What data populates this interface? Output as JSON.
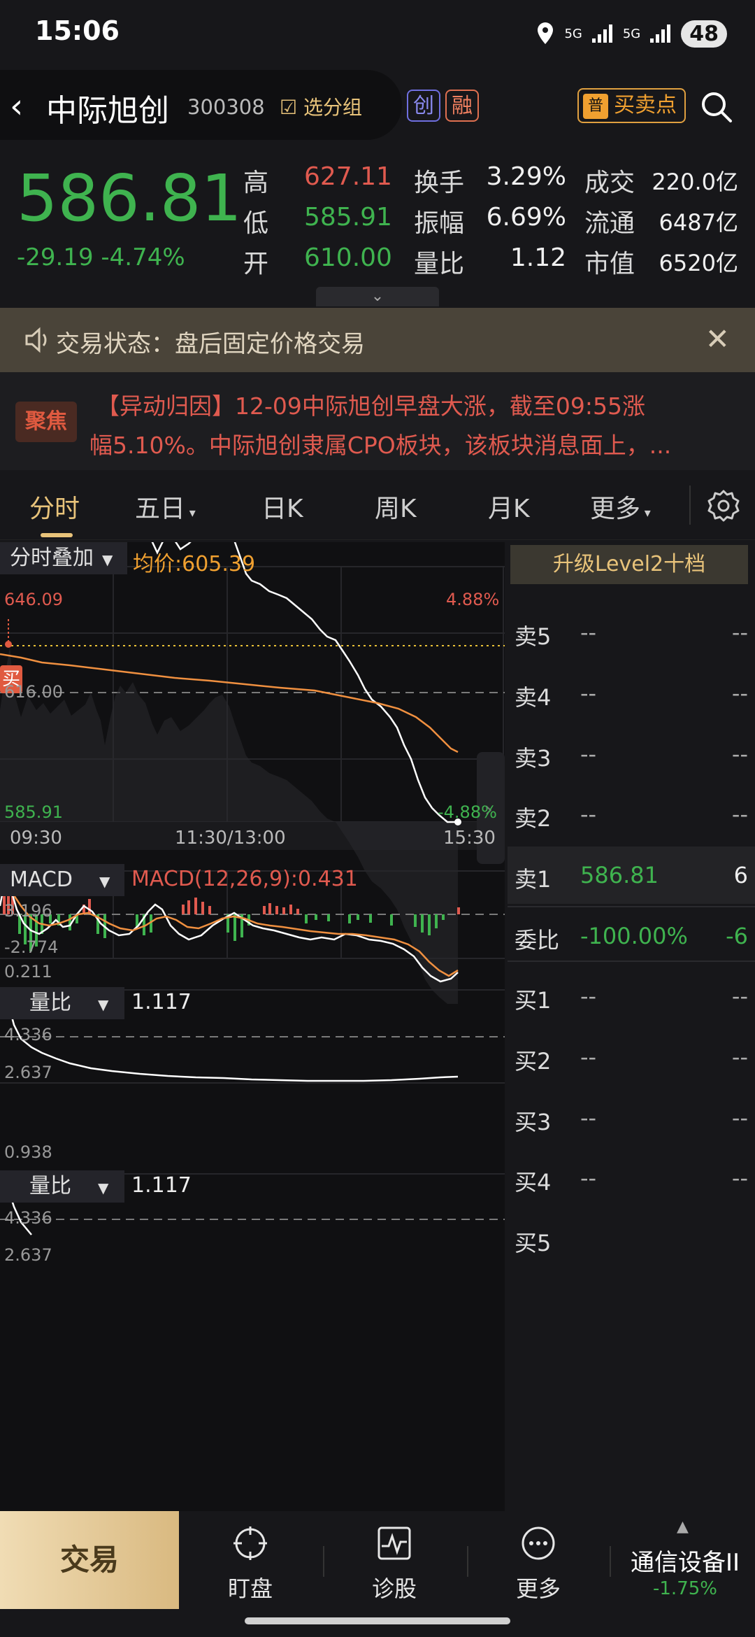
{
  "status": {
    "time": "15:06",
    "net1": "5G",
    "net2": "5G",
    "battery": "48"
  },
  "header": {
    "name": "中际旭创",
    "code": "300308",
    "group_btn": "选分组",
    "badge1": "创",
    "badge2": "融",
    "buysell_icon": "普",
    "buysell": "买卖点"
  },
  "quote": {
    "price": "586.81",
    "change": "-29.19 -4.74%",
    "high_label": "高",
    "high": "627.11",
    "low_label": "低",
    "low": "585.91",
    "open_label": "开",
    "open": "610.00",
    "turnover_label": "换手",
    "turnover": "3.29%",
    "amplitude_label": "振幅",
    "amplitude": "6.69%",
    "volratio_label": "量比",
    "volratio": "1.12",
    "deal_label": "成交",
    "deal": "220.0亿",
    "float_label": "流通",
    "float": "6487亿",
    "mktcap_label": "市值",
    "mktcap": "6520亿",
    "colors": {
      "up": "#e05a4f",
      "down": "#3fb34f"
    }
  },
  "trade_status": {
    "text": "交易状态：盘后固定价格交易"
  },
  "news": {
    "tag": "聚焦",
    "line1": "【异动归因】12-09中际旭创早盘大涨，截至09:55涨",
    "line2": "幅5.10%。中际旭创隶属CPO板块，该板块消息面上，..."
  },
  "tabs": [
    "分时",
    "五日",
    "日K",
    "周K",
    "月K",
    "更多"
  ],
  "intraday": {
    "overlay_btn": "分时叠加",
    "avg_label": "均价:605.39",
    "high_price": "646.09",
    "high_pct": "4.88%",
    "low_price": "585.91",
    "low_pct": "-4.88%",
    "mid_label": "616.00",
    "buy_marker": "买",
    "time_start": "09:30",
    "time_mid": "11:30/13:00",
    "time_end": "15:30"
  },
  "macd": {
    "btn": "MACD",
    "label": "MACD(12,26,9):0.431",
    "top": "3.196",
    "mid": "0.211",
    "bottom": "-2.774"
  },
  "volratio1": {
    "btn": "量比",
    "value": "1.117",
    "top": "4.336",
    "mid": "2.637",
    "bottom": "0.938"
  },
  "volratio2": {
    "btn": "量比",
    "value": "1.117",
    "top": "4.336",
    "mid": "2.637"
  },
  "orderbook": {
    "level2_btn": "升级Level2十档",
    "sell": [
      {
        "name": "卖5",
        "price": "--",
        "vol": "--"
      },
      {
        "name": "卖4",
        "price": "--",
        "vol": "--"
      },
      {
        "name": "卖3",
        "price": "--",
        "vol": "--"
      },
      {
        "name": "卖2",
        "price": "--",
        "vol": "--"
      },
      {
        "name": "卖1",
        "price": "586.81",
        "vol": "6"
      }
    ],
    "ratio": {
      "name": "委比",
      "price": "-100.00%",
      "vol": "-6"
    },
    "buy": [
      {
        "name": "买1",
        "price": "--",
        "vol": "--"
      },
      {
        "name": "买2",
        "price": "--",
        "vol": "--"
      },
      {
        "name": "买3",
        "price": "--",
        "vol": "--"
      },
      {
        "name": "买4",
        "price": "--",
        "vol": "--"
      },
      {
        "name": "买5",
        "price": "",
        "vol": ""
      }
    ]
  },
  "bottom_nav": {
    "trade": "交易",
    "items": [
      "盯盘",
      "诊股",
      "更多"
    ],
    "sector_name": "通信设备II",
    "sector_change": "-1.75%"
  }
}
